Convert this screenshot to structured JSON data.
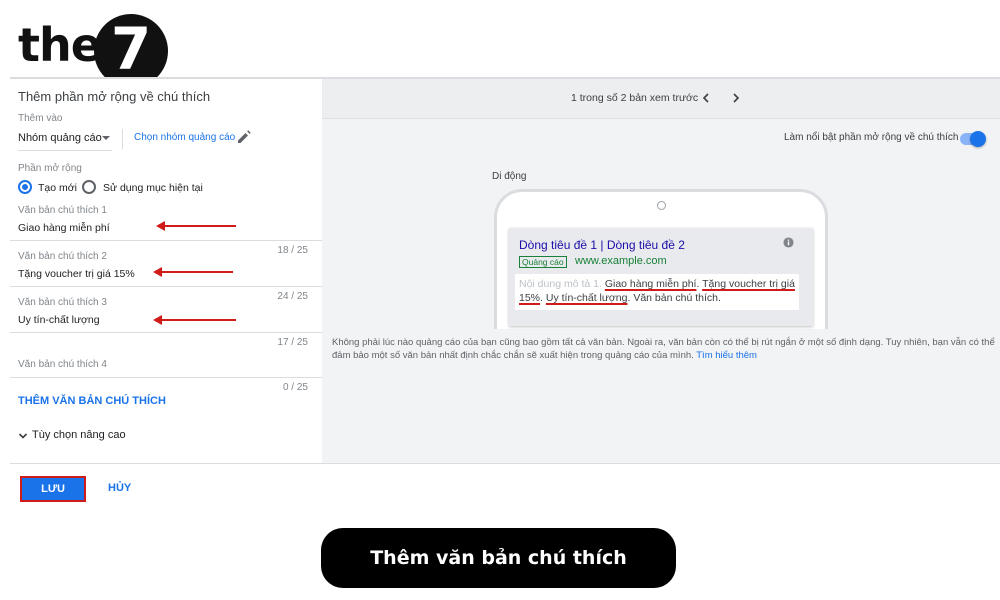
{
  "logo": {
    "text": "the",
    "number": "7"
  },
  "left_panel": {
    "title": "Thêm phần mở rộng về chú thích",
    "add_to_label": "Thêm vào",
    "add_to_value": "Nhóm quảng cáo",
    "choose_group_link": "Chọn nhóm quảng cáo",
    "extension_label": "Phần mở rộng",
    "radio_new": "Tạo mới",
    "radio_existing": "Sử dụng mục hiện tại",
    "callouts": [
      {
        "label": "Văn bản chú thích 1",
        "value": "Giao hàng miễn phí",
        "count": "18 / 25"
      },
      {
        "label": "Văn bản chú thích 2",
        "value": "Tặng voucher trị giá 15%",
        "count": "24 / 25"
      },
      {
        "label": "Văn bản chú thích 3",
        "value": "Uy tín-chất lượng",
        "count": "17 / 25"
      },
      {
        "label": "Văn bản chú thích 4",
        "value": "",
        "count": "0 / 25"
      }
    ],
    "add_callout_link": "THÊM VĂN BẢN CHÚ THÍCH",
    "advanced_options": "Tùy chọn nâng cao"
  },
  "preview": {
    "pager_text": "1 trong số 2 bản xem trước",
    "highlight_toggle_label": "Làm nổi bật phần mở rộng về chú thích",
    "device_label": "Di động",
    "ad": {
      "headline": "Dòng tiêu đề 1 | Dòng tiêu đề 2",
      "badge": "Quảng cáo",
      "url": "www.example.com",
      "desc_prefix": "Nội dung mô tả 1.",
      "callout_1": "Giao hàng miễn phí",
      "sep": ".",
      "callout_2": "Tặng voucher trị giá 15%",
      "callout_3": "Uy tín-chất lượng",
      "callout_4": "Văn bản chú thích",
      "end": "."
    },
    "disclaimer": "Không phải lúc nào quảng cáo của bạn cũng bao gồm tất cả văn bản. Ngoài ra, văn bản còn có thể bị rút ngắn ở một số định dạng. Tuy nhiên, bạn vẫn có thể đảm bảo một số văn bản nhất định chắc chắn sẽ xuất hiện trong quảng cáo của mình.",
    "learn_more": "Tìm hiểu thêm"
  },
  "actions": {
    "save": "LƯU",
    "cancel": "HỦY"
  },
  "caption": "Thêm văn bản chú thích",
  "colors": {
    "accent": "#1a73e8",
    "annotation_red": "#d11a1a",
    "panel_bg": "#f1f3f4"
  },
  "icons": [
    "pencil-icon",
    "dropdown-caret-icon",
    "chevron-left-icon",
    "chevron-right-icon",
    "info-icon",
    "chevron-down-icon"
  ]
}
